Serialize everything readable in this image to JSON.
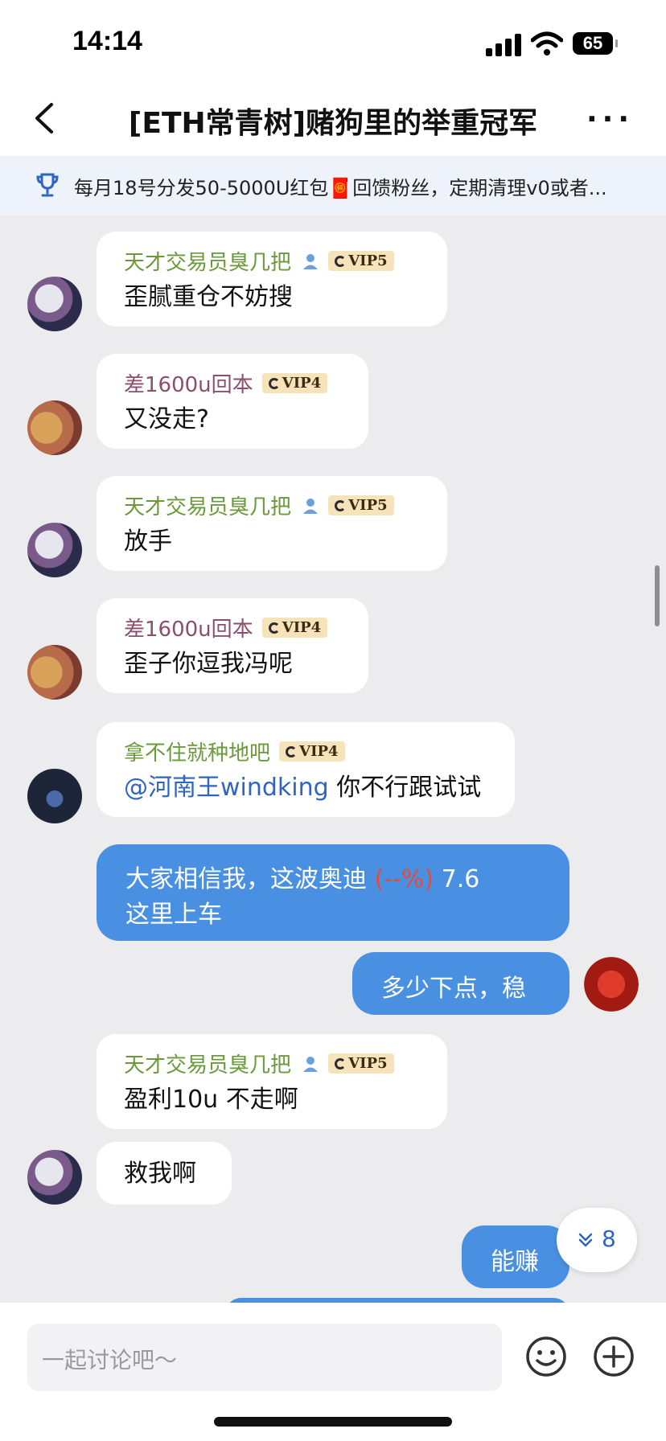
{
  "status_bar": {
    "time": "14:14",
    "battery": "65"
  },
  "header": {
    "title": "[ETH常青树]赌狗里的举重冠军"
  },
  "notice": {
    "text": "每月18号分发50-5000U红包🧧回馈粉丝，定期清理v0或者..."
  },
  "messages": [
    {
      "sender": "天才交易员臭几把",
      "vip": "VIP5",
      "text": "歪腻重仓不妨搜"
    },
    {
      "sender": "差1600u回本",
      "vip": "VIP4",
      "text": "又没走?"
    },
    {
      "sender": "天才交易员臭几把",
      "vip": "VIP5",
      "text": "放手"
    },
    {
      "sender": "差1600u回本",
      "vip": "VIP4",
      "text": "歪子你逗我冯呢"
    },
    {
      "sender": "拿不住就种地吧",
      "vip": "VIP4",
      "mention": "@河南王windking",
      "text": " 你不行跟试试"
    },
    {
      "line1_prefix": "大家相信我，这波奥迪 ",
      "line1_red": "(--%)",
      "line1_suffix": " 7.6",
      "line2": "这里上车"
    },
    {
      "text": "多少下点，稳"
    },
    {
      "sender": "天才交易员臭几把",
      "vip": "VIP5",
      "text": "盈利10u 不走啊"
    },
    {
      "text": "救我啊"
    },
    {
      "text": "能赚"
    }
  ],
  "jump_button": {
    "count": "8"
  },
  "input": {
    "placeholder": "一起讨论吧～"
  },
  "colors": {
    "accent": "#4a90e2",
    "background": "#ececef"
  }
}
